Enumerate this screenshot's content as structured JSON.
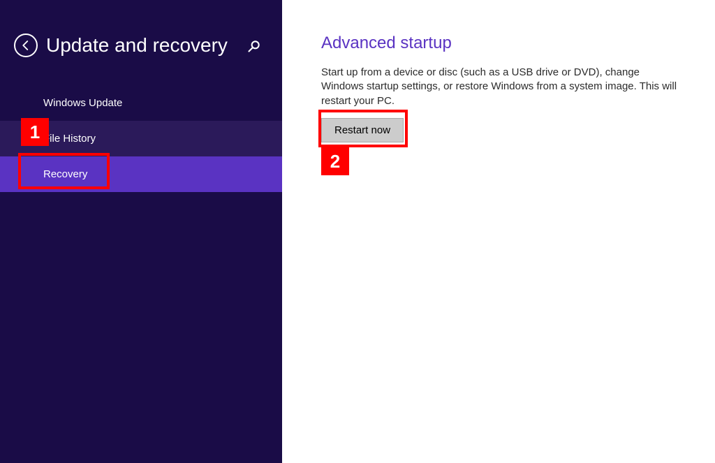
{
  "header": {
    "title": "Update and recovery"
  },
  "sidebar": {
    "items": [
      {
        "label": "Windows Update"
      },
      {
        "label": "File History"
      },
      {
        "label": "Recovery"
      }
    ]
  },
  "main": {
    "section_title": "Advanced startup",
    "section_desc": "Start up from a device or disc (such as a USB drive or DVD), change Windows startup settings, or restore Windows from a system image. This will restart your PC.",
    "button_label": "Restart now"
  },
  "annotations": {
    "one": "1",
    "two": "2"
  }
}
